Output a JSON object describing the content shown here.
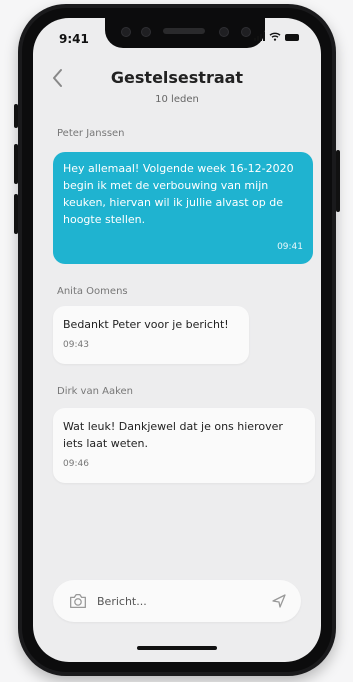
{
  "status": {
    "time": "9:41"
  },
  "header": {
    "title": "Gestelsestraat",
    "subtitle": "10 leden"
  },
  "messages": [
    {
      "sender": "Peter Janssen",
      "text": "Hey allemaal! Volgende week 16-12-2020 begin ik met de verbouwing van mijn keuken, hiervan wil ik jullie alvast op de hoogte stellen.",
      "time": "09:41",
      "direction": "outgoing"
    },
    {
      "sender": "Anita Oomens",
      "text": "Bedankt Peter voor je bericht!",
      "time": "09:43",
      "direction": "incoming"
    },
    {
      "sender": "Dirk van Aaken",
      "text": "Wat leuk! Dankjewel dat je ons hierover iets laat weten.",
      "time": "09:46",
      "direction": "incoming"
    }
  ],
  "composer": {
    "placeholder": "Bericht..."
  },
  "icons": {
    "back": "chevron-left-icon",
    "camera": "camera-icon",
    "send": "send-icon",
    "signal": "signal-icon",
    "wifi": "wifi-icon",
    "battery": "battery-icon"
  },
  "colors": {
    "accent": "#1fb3d0",
    "screen_bg": "#ededee",
    "bubble_bg": "#fafafa"
  }
}
